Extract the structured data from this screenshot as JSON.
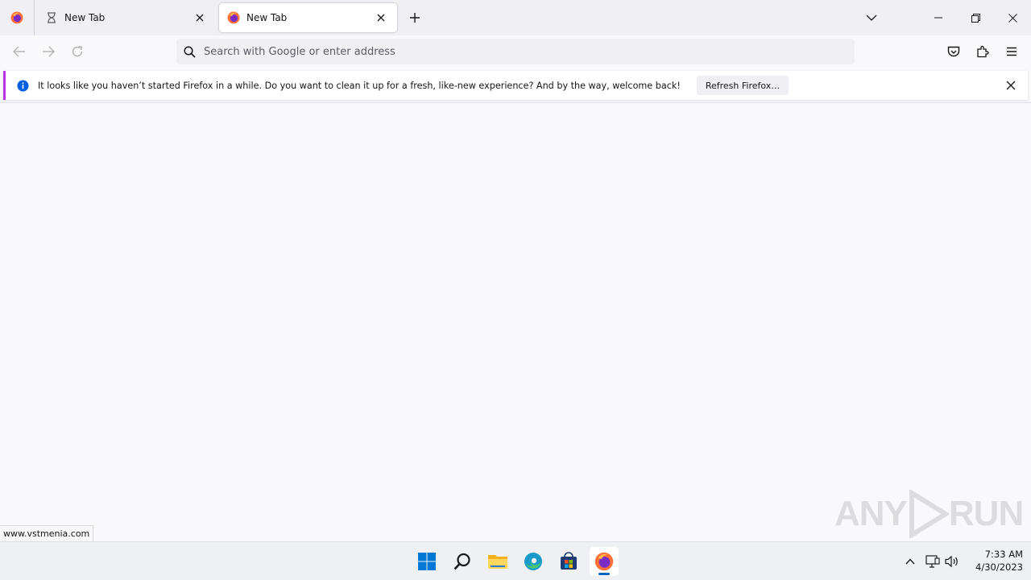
{
  "browser": {
    "tabs": [
      {
        "title": "New Tab",
        "active": false
      },
      {
        "title": "New Tab",
        "active": true
      }
    ],
    "urlbar": {
      "placeholder": "Search with Google or enter address",
      "value": ""
    }
  },
  "notification": {
    "message": "It looks like you haven’t started Firefox in a while. Do you want to clean it up for a fresh, like-new experience? And by the way, welcome back!",
    "button_label": "Refresh Firefox…",
    "accent_color": "#b833e1"
  },
  "status": {
    "link_url": "www.vstmenia.com"
  },
  "watermark": {
    "text_left": "ANY",
    "text_right": "RUN"
  },
  "taskbar": {
    "apps": [
      "windows-start-icon",
      "search-icon",
      "file-explorer-icon",
      "edge-icon",
      "store-icon",
      "firefox-icon"
    ],
    "clock": {
      "time": "7:33 AM",
      "date": "4/30/2023"
    }
  },
  "colors": {
    "accent_blue": "#0067c0",
    "tab_strip": "#f0f0f4",
    "page_bg": "#f9f9fb"
  }
}
